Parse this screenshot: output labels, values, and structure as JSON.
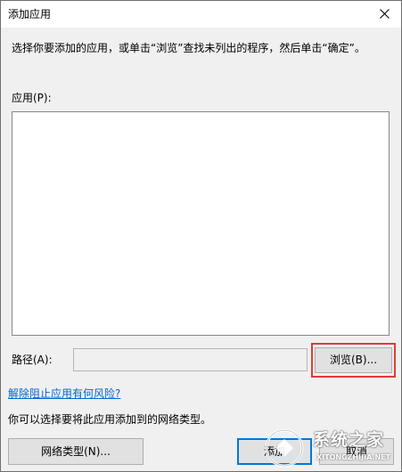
{
  "window": {
    "title": "添加应用"
  },
  "instruction": "选择你要添加的应用，或单击“浏览”查找未列出的程序，然后单击“确定”。",
  "apps": {
    "label": "应用(P):",
    "items": []
  },
  "path": {
    "label": "路径(A):",
    "value": "",
    "browse_label": "浏览(B)..."
  },
  "risk_link": "解除阻止应用有何风险?",
  "network": {
    "text": "你可以选择要将此应用添加到的网络类型。",
    "button_label": "网络类型(N)..."
  },
  "buttons": {
    "add_label": "添加",
    "cancel_label": "取消"
  },
  "watermark": {
    "name": "系统之家",
    "url": "XITONGZHIJIA.NET"
  },
  "colors": {
    "highlight": "#e03a3a",
    "link": "#0066cc",
    "default_button_border": "#0078d7"
  }
}
